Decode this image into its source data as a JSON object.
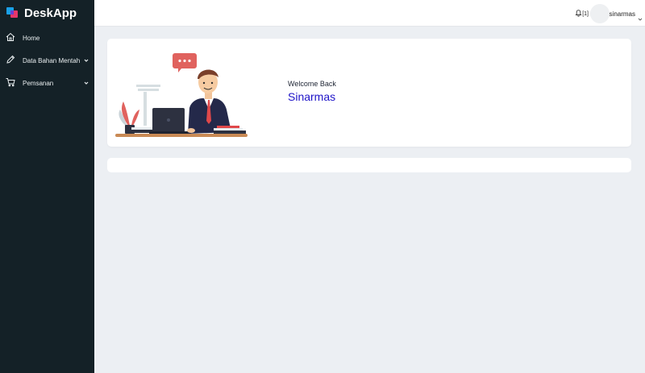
{
  "app": {
    "name": "DeskApp"
  },
  "sidebar": {
    "items": [
      {
        "label": "Home",
        "icon": "home-icon",
        "has_submenu": false
      },
      {
        "label": "Data Bahan Mentah",
        "icon": "pencil-icon",
        "has_submenu": true
      },
      {
        "label": "Pemsanan",
        "icon": "cart-icon",
        "has_submenu": true
      }
    ]
  },
  "header": {
    "notification_count": "[1]",
    "user_name": "sinarmas"
  },
  "main": {
    "welcome_text": "Welcome Back",
    "welcome_name": "Sinarmas"
  },
  "colors": {
    "sidebar_bg": "#142127",
    "accent": "#1f14c8",
    "page_bg": "#eceff3"
  }
}
